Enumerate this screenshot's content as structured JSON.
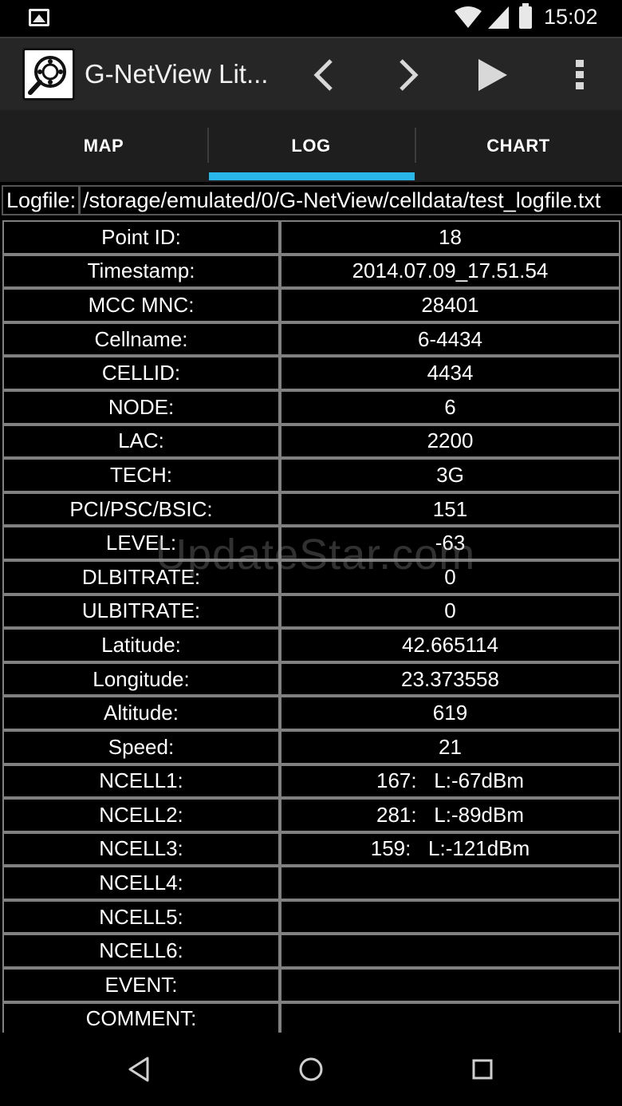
{
  "status_bar": {
    "time": "15:02",
    "icons": [
      "image-icon",
      "wifi-icon",
      "signal-icon",
      "battery-icon"
    ]
  },
  "action_bar": {
    "title": "G-NetView Lit...",
    "icons": [
      "app-logo-icon",
      "chevron-left-icon",
      "chevron-right-icon",
      "play-icon",
      "overflow-menu-icon"
    ]
  },
  "tabs": [
    {
      "label": "MAP",
      "selected": false
    },
    {
      "label": "LOG",
      "selected": true
    },
    {
      "label": "CHART",
      "selected": false
    }
  ],
  "accent_color": "#29b6e8",
  "logfile": {
    "label": "Logfile:",
    "path": "/storage/emulated/0/G-NetView/celldata/test_logfile.txt"
  },
  "table": {
    "rows": [
      {
        "label": "Point ID:",
        "value": "18"
      },
      {
        "label": "Timestamp:",
        "value": "2014.07.09_17.51.54"
      },
      {
        "label": "MCC MNC:",
        "value": "28401"
      },
      {
        "label": "Cellname:",
        "value": "6-4434"
      },
      {
        "label": "CELLID:",
        "value": "4434"
      },
      {
        "label": "NODE:",
        "value": "6"
      },
      {
        "label": "LAC:",
        "value": "2200"
      },
      {
        "label": "TECH:",
        "value": "3G"
      },
      {
        "label": "PCI/PSC/BSIC:",
        "value": "151"
      },
      {
        "label": "LEVEL:",
        "value": "-63"
      },
      {
        "label": "DLBITRATE:",
        "value": "0"
      },
      {
        "label": "ULBITRATE:",
        "value": "0"
      },
      {
        "label": "Latitude:",
        "value": "42.665114"
      },
      {
        "label": "Longitude:",
        "value": "23.373558"
      },
      {
        "label": "Altitude:",
        "value": "619"
      },
      {
        "label": "Speed:",
        "value": "21"
      },
      {
        "label": "NCELL1:",
        "value": "167:   L:-67dBm"
      },
      {
        "label": "NCELL2:",
        "value": "281:   L:-89dBm"
      },
      {
        "label": "NCELL3:",
        "value": "159:   L:-121dBm"
      },
      {
        "label": "NCELL4:",
        "value": ""
      },
      {
        "label": "NCELL5:",
        "value": ""
      },
      {
        "label": "NCELL6:",
        "value": ""
      },
      {
        "label": "EVENT:",
        "value": ""
      },
      {
        "label": "COMMENT:",
        "value": ""
      }
    ]
  },
  "watermark": "UpdateStar.com",
  "nav_bar": {
    "icons": [
      "back-icon",
      "home-icon",
      "recents-icon"
    ]
  }
}
